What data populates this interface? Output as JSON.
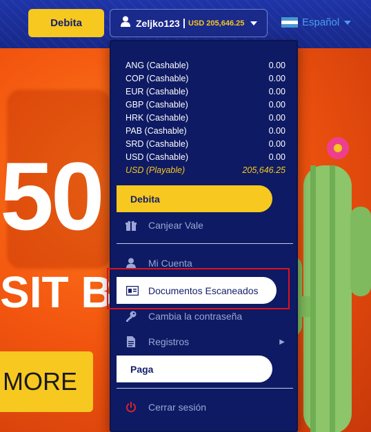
{
  "header": {
    "debita_label": "Debita",
    "username": "Zeljko123",
    "separator": "|",
    "balance_label": "USD 205,646.25",
    "language": "Español",
    "flag_colors": [
      "#4997d0",
      "#ffffff",
      "#4997d0"
    ]
  },
  "hero": {
    "big_number": "50",
    "deposit_text": "SIT BO",
    "more_label": "MORE"
  },
  "menu": {
    "balances": [
      {
        "currency": "ANG (Cashable)",
        "amount": "0.00"
      },
      {
        "currency": "COP (Cashable)",
        "amount": "0.00"
      },
      {
        "currency": "EUR (Cashable)",
        "amount": "0.00"
      },
      {
        "currency": "GBP (Cashable)",
        "amount": "0.00"
      },
      {
        "currency": "HRK (Cashable)",
        "amount": "0.00"
      },
      {
        "currency": "PAB (Cashable)",
        "amount": "0.00"
      },
      {
        "currency": "SRD (Cashable)",
        "amount": "0.00"
      },
      {
        "currency": "USD (Cashable)",
        "amount": "0.00"
      },
      {
        "currency": "USD (Playable)",
        "amount": "205,646.25"
      }
    ],
    "debita_label": "Debita",
    "canjear_label": "Canjear Vale",
    "mi_cuenta_label": "Mi Cuenta",
    "documentos_label": "Documentos Escaneados",
    "cambia_label": "Cambia la contraseña",
    "registros_label": "Registros",
    "paga_label": "Paga",
    "cerrar_label": "Cerrar sesión"
  },
  "colors": {
    "accent_yellow": "#f7c81f",
    "menu_bg": "#0e1a63",
    "highlight_red": "#e0121c",
    "logout_red": "#e0222a"
  }
}
